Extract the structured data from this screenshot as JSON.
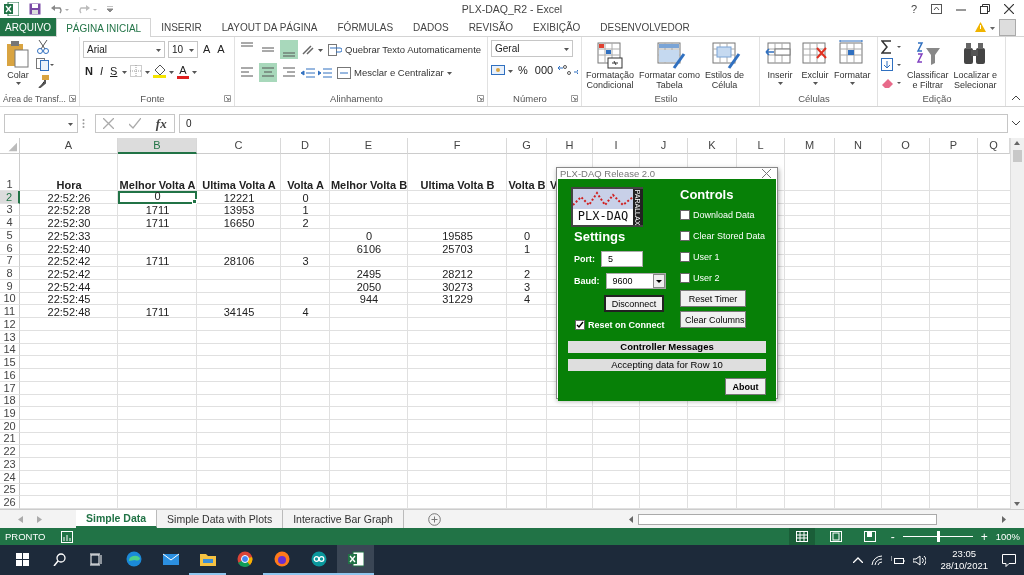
{
  "window": {
    "title": "PLX-DAQ_R2 - Excel",
    "help": "?"
  },
  "ribbon_tabs": [
    {
      "label": "ARQUIVO",
      "kind": "file",
      "selected": false
    },
    {
      "label": "PÁGINA INICIAL",
      "kind": "tab",
      "selected": true
    },
    {
      "label": "INSERIR",
      "kind": "tab",
      "selected": false
    },
    {
      "label": "LAYOUT DA PÁGINA",
      "kind": "tab",
      "selected": false
    },
    {
      "label": "FÓRMULAS",
      "kind": "tab",
      "selected": false
    },
    {
      "label": "DADOS",
      "kind": "tab",
      "selected": false
    },
    {
      "label": "REVISÃO",
      "kind": "tab",
      "selected": false
    },
    {
      "label": "EXIBIÇÃO",
      "kind": "tab",
      "selected": false
    },
    {
      "label": "DESENVOLVEDOR",
      "kind": "tab",
      "selected": false
    }
  ],
  "ribbon_groups": [
    {
      "kind": "clipboard",
      "label": "Área de Transf...",
      "paste": "Colar"
    },
    {
      "kind": "font",
      "label": "Fonte",
      "font": "Arial",
      "size": "10",
      "grow": "A",
      "shrink": "A",
      "bold": "N",
      "italic": "I",
      "underline": "S",
      "font_color": "A"
    },
    {
      "kind": "alignment",
      "label": "Alinhamento",
      "vertical_align": [
        {
          "selected": false
        },
        {
          "selected": false
        },
        {
          "selected": true
        }
      ],
      "horizontal_align": [
        {
          "selected": false
        },
        {
          "selected": true
        },
        {
          "selected": false
        }
      ],
      "wrap": "Quebrar Texto Automaticamente",
      "merge": "Mesclar e Centralizar"
    },
    {
      "kind": "number",
      "label": "Número",
      "format": "Geral",
      "percent": "%",
      "thousands": "000"
    },
    {
      "kind": "styles",
      "label": "Estilo",
      "buttons": [
        {
          "lines": [
            "Formatação",
            "Condicional"
          ]
        },
        {
          "lines": [
            "Formatar como",
            "Tabela"
          ]
        },
        {
          "lines": [
            "Estilos de",
            "Célula"
          ]
        }
      ]
    },
    {
      "kind": "cells",
      "label": "Células",
      "buttons": [
        {
          "lines": [
            "Inserir"
          ]
        },
        {
          "lines": [
            "Excluir"
          ]
        },
        {
          "lines": [
            "Formatar"
          ]
        }
      ]
    },
    {
      "kind": "editing",
      "label": "Edição",
      "buttons": [
        {
          "lines": [
            "Classificar",
            "e Filtrar"
          ]
        },
        {
          "lines": [
            "Localizar e",
            "Selecionar"
          ]
        }
      ]
    }
  ],
  "formula_bar": {
    "function_label": "fx",
    "value": "0"
  },
  "sheet": {
    "columns": [
      {
        "letter": "A",
        "selected": false
      },
      {
        "letter": "B",
        "selected": true
      },
      {
        "letter": "C",
        "selected": false
      },
      {
        "letter": "D",
        "selected": false
      },
      {
        "letter": "E",
        "selected": false
      },
      {
        "letter": "F",
        "selected": false
      },
      {
        "letter": "G",
        "selected": false
      },
      {
        "letter": "H",
        "selected": false
      },
      {
        "letter": "I",
        "selected": false
      },
      {
        "letter": "J",
        "selected": false
      },
      {
        "letter": "K",
        "selected": false
      },
      {
        "letter": "L",
        "selected": false
      },
      {
        "letter": "M",
        "selected": false
      },
      {
        "letter": "N",
        "selected": false
      },
      {
        "letter": "O",
        "selected": false
      },
      {
        "letter": "P",
        "selected": false
      },
      {
        "letter": "Q",
        "selected": false
      }
    ],
    "rows": [
      {
        "number": "1",
        "kind": "header",
        "selected": false,
        "cells": {
          "A": "Hora",
          "B": "Melhor Volta A",
          "C": "Ultima Volta A",
          "D": "Volta A",
          "E": "Melhor Volta B",
          "F": "Ultima Volta B",
          "G": "Volta B",
          "H": "V"
        }
      },
      {
        "number": "2",
        "kind": "data",
        "selected": true,
        "cells": {
          "A": "22:52:26",
          "B": "0",
          "C": "12221",
          "D": "0"
        }
      },
      {
        "number": "3",
        "kind": "data",
        "selected": false,
        "cells": {
          "A": "22:52:28",
          "B": "1711",
          "C": "13953",
          "D": "1"
        }
      },
      {
        "number": "4",
        "kind": "data",
        "selected": false,
        "cells": {
          "A": "22:52:30",
          "B": "1711",
          "C": "16650",
          "D": "2"
        }
      },
      {
        "number": "5",
        "kind": "data",
        "selected": false,
        "cells": {
          "A": "22:52:33",
          "E": "0",
          "F": "19585",
          "G": "0"
        }
      },
      {
        "number": "6",
        "kind": "data",
        "selected": false,
        "cells": {
          "A": "22:52:40",
          "E": "6106",
          "F": "25703",
          "G": "1"
        }
      },
      {
        "number": "7",
        "kind": "data",
        "selected": false,
        "cells": {
          "A": "22:52:42",
          "B": "1711",
          "C": "28106",
          "D": "3"
        }
      },
      {
        "number": "8",
        "kind": "data",
        "selected": false,
        "cells": {
          "A": "22:52:42",
          "E": "2495",
          "F": "28212",
          "G": "2"
        }
      },
      {
        "number": "9",
        "kind": "data",
        "selected": false,
        "cells": {
          "A": "22:52:44",
          "E": "2050",
          "F": "30273",
          "G": "3"
        }
      },
      {
        "number": "10",
        "kind": "data",
        "selected": false,
        "cells": {
          "A": "22:52:45",
          "E": "944",
          "F": "31229",
          "G": "4"
        }
      },
      {
        "number": "11",
        "kind": "data",
        "selected": false,
        "cells": {
          "A": "22:52:48",
          "B": "1711",
          "C": "34145",
          "D": "4"
        }
      },
      {
        "number": "12",
        "kind": "data",
        "selected": false
      },
      {
        "number": "13",
        "kind": "data",
        "selected": false
      },
      {
        "number": "14",
        "kind": "data",
        "selected": false
      },
      {
        "number": "15",
        "kind": "data",
        "selected": false
      },
      {
        "number": "16",
        "kind": "data",
        "selected": false
      },
      {
        "number": "17",
        "kind": "data",
        "selected": false
      },
      {
        "number": "18",
        "kind": "data",
        "selected": false
      },
      {
        "number": "19",
        "kind": "data",
        "selected": false
      },
      {
        "number": "20",
        "kind": "data",
        "selected": false
      },
      {
        "number": "21",
        "kind": "data",
        "selected": false
      },
      {
        "number": "22",
        "kind": "data",
        "selected": false
      },
      {
        "number": "23",
        "kind": "data",
        "selected": false
      },
      {
        "number": "24",
        "kind": "data",
        "selected": false
      },
      {
        "number": "25",
        "kind": "data",
        "selected": false
      },
      {
        "number": "26",
        "kind": "data",
        "selected": false
      }
    ]
  },
  "sheet_tabs": [
    {
      "label": "Simple Data",
      "selected": true
    },
    {
      "label": "Simple Data with Plots",
      "selected": false
    },
    {
      "label": "Interactive Bar Graph",
      "selected": false
    }
  ],
  "status_bar": {
    "status": "PRONTO",
    "views": [
      {
        "selected": true
      },
      {
        "selected": false
      },
      {
        "selected": false
      }
    ],
    "zoom_out": "-",
    "zoom_in": "+",
    "zoom": {
      "level": 0.5
    },
    "zoom_label": "100%"
  },
  "plx_daq": {
    "title": "PLX-DAQ Release 2.0",
    "logo": "PLX-DAQ",
    "logo_side": "PARALLAX",
    "settings_heading": "Settings",
    "port_label": "Port:",
    "port": "5",
    "baud_label": "Baud:",
    "baud": "9600",
    "disconnect": "Disconnect",
    "reset_on_connect": {
      "label": "Reset on Connect",
      "checked": true
    },
    "controls_heading": "Controls",
    "checkboxes": [
      {
        "label": "Download Data",
        "checked": false
      },
      {
        "label": "Clear Stored Data",
        "checked": false
      },
      {
        "label": "User 1",
        "checked": false
      },
      {
        "label": "User 2",
        "checked": false
      }
    ],
    "reset_timer": "Reset Timer",
    "clear_columns": "Clear Columns",
    "messages_heading": "Controller Messages",
    "message": "Accepting data for Row 10",
    "about": "About"
  },
  "taskbar": {
    "apps": [
      {
        "running": false,
        "active": false
      },
      {
        "running": false,
        "active": false
      },
      {
        "running": true,
        "active": false
      },
      {
        "running": false,
        "active": false
      },
      {
        "running": true,
        "active": false
      },
      {
        "running": true,
        "active": false
      },
      {
        "running": true,
        "active": true
      }
    ],
    "time": "23:05",
    "date": "28/10/2021"
  }
}
